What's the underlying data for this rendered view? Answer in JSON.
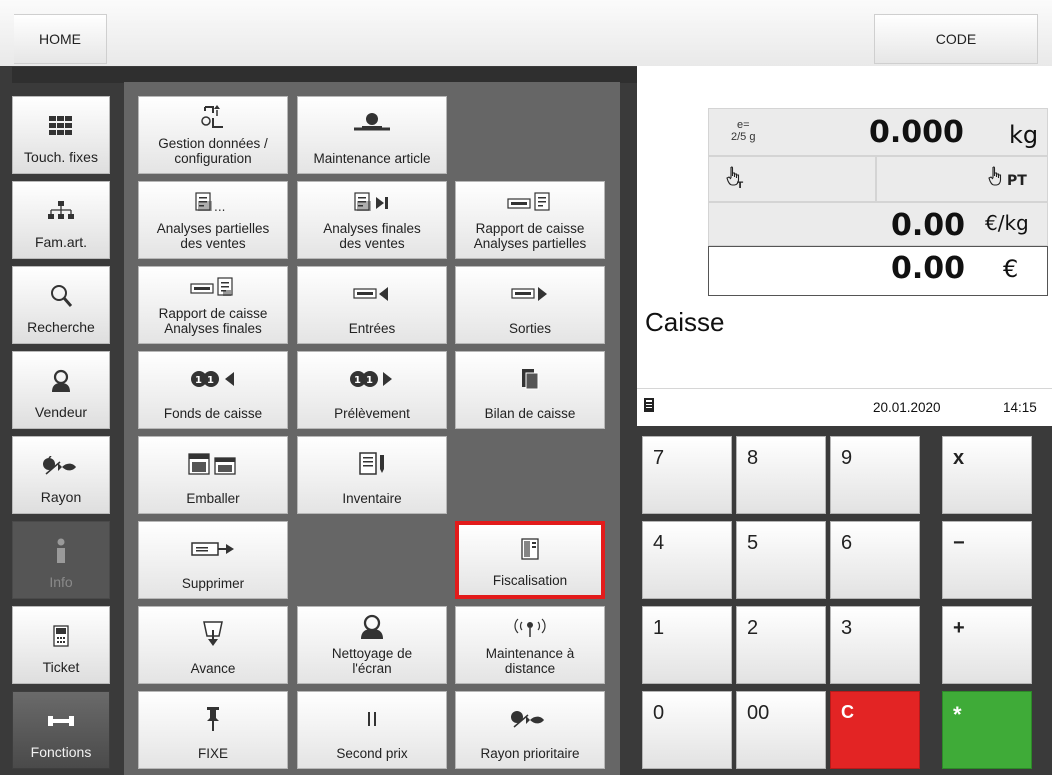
{
  "top": {
    "home_label": "HOME",
    "code_label": "CODE"
  },
  "sidebar": [
    {
      "label": "Touch. fixes",
      "icon": "grid-icon"
    },
    {
      "label": "Fam.art.",
      "icon": "hierarchy-icon"
    },
    {
      "label": "Recherche",
      "icon": "search-icon"
    },
    {
      "label": "Vendeur",
      "icon": "user-icon"
    },
    {
      "label": "Rayon",
      "icon": "apple-fish-icon"
    },
    {
      "label": "Info",
      "icon": "info-icon",
      "state": "disabled"
    },
    {
      "label": "Ticket",
      "icon": "ticket-icon"
    },
    {
      "label": "Fonctions",
      "icon": "wrench-icon",
      "state": "selected"
    }
  ],
  "tiles": [
    [
      {
        "label": "Gestion données /\nconfiguration",
        "icon": "data-config-icon"
      },
      {
        "label": "Maintenance article",
        "icon": "article-maintenance-icon"
      },
      null
    ],
    [
      {
        "label": "Analyses partielles\ndes ventes",
        "icon": "partial-sales-icon"
      },
      {
        "label": "Analyses finales\ndes ventes",
        "icon": "final-sales-icon"
      },
      {
        "label": "Rapport de caisse\nAnalyses partielles",
        "icon": "cash-report-partial-icon"
      }
    ],
    [
      {
        "label": "Rapport de caisse\nAnalyses finales",
        "icon": "cash-report-final-icon"
      },
      {
        "label": "Entrées",
        "icon": "cash-in-icon"
      },
      {
        "label": "Sorties",
        "icon": "cash-out-icon"
      }
    ],
    [
      {
        "label": "Fonds de caisse",
        "icon": "cash-float-icon"
      },
      {
        "label": "Prélèvement",
        "icon": "withdrawal-icon"
      },
      {
        "label": "Bilan de caisse",
        "icon": "cash-balance-icon"
      }
    ],
    [
      {
        "label": "Emballer",
        "icon": "pack-icon"
      },
      {
        "label": "Inventaire",
        "icon": "inventory-icon"
      },
      null
    ],
    [
      {
        "label": "Supprimer",
        "icon": "delete-icon"
      },
      null,
      {
        "label": "Fiscalisation",
        "icon": "fiscal-icon",
        "highlighted": true
      }
    ],
    [
      {
        "label": "Avance",
        "icon": "feed-icon"
      },
      {
        "label": "Nettoyage de\nl'écran",
        "icon": "screen-clean-icon"
      },
      {
        "label": "Maintenance à\ndistance",
        "icon": "remote-maintenance-icon"
      }
    ],
    [
      {
        "label": "FIXE",
        "icon": "pin-icon"
      },
      {
        "label": "Second prix",
        "icon": "pause-icon"
      },
      {
        "label": "Rayon prioritaire",
        "icon": "priority-department-icon"
      }
    ]
  ],
  "display": {
    "division": "e=\n2/5 g",
    "weight": "0.000",
    "weight_unit": "kg",
    "tare_icon": "hand-T-icon",
    "preset_tare_label": "PT",
    "unit_price": "0.00",
    "unit_price_unit": "€/kg",
    "total": "0.00",
    "total_unit": "€",
    "mode_title": "Caisse",
    "date": "20.01.2020",
    "time": "14:15"
  },
  "keypad": [
    [
      "7",
      "8",
      "9",
      "x"
    ],
    [
      "4",
      "5",
      "6",
      "−"
    ],
    [
      "1",
      "2",
      "3",
      "+"
    ],
    [
      "0",
      "00",
      "C",
      "*"
    ]
  ]
}
